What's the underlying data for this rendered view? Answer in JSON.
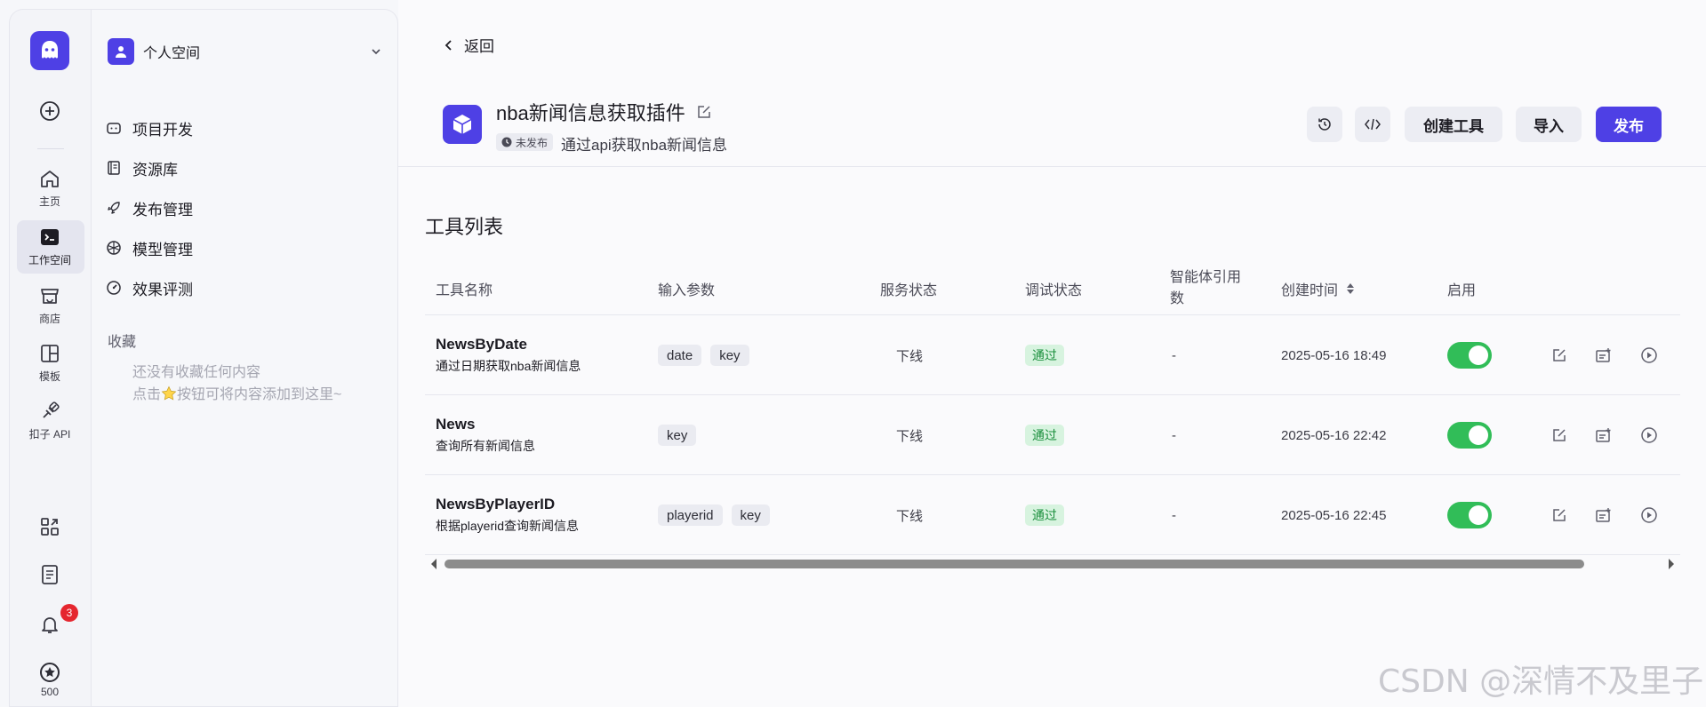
{
  "rail": {
    "items": [
      {
        "label": "",
        "icon": "plus-circle-icon"
      },
      {
        "label": "主页",
        "icon": "home-icon"
      },
      {
        "label": "工作空间",
        "icon": "terminal-icon"
      },
      {
        "label": "商店",
        "icon": "store-icon"
      },
      {
        "label": "模板",
        "icon": "template-icon"
      },
      {
        "label": "扣子 API",
        "icon": "api-icon"
      }
    ],
    "notification_count": "3",
    "points": "500"
  },
  "sidebar": {
    "space_name": "个人空间",
    "items": [
      {
        "label": "项目开发",
        "icon": "robot-icon"
      },
      {
        "label": "资源库",
        "icon": "library-icon"
      },
      {
        "label": "发布管理",
        "icon": "rocket-icon"
      },
      {
        "label": "模型管理",
        "icon": "model-icon"
      },
      {
        "label": "效果评测",
        "icon": "gauge-icon"
      }
    ],
    "favorites_title": "收藏",
    "favorites_empty_line1": "还没有收藏任何内容",
    "favorites_empty_line2_a": "点击",
    "favorites_empty_line2_b": "按钮可将内容添加到这里~"
  },
  "header": {
    "back_label": "返回",
    "plugin_name": "nba新闻信息获取插件",
    "status": "未发布",
    "description": "通过api获取nba新闻信息",
    "create_tool": "创建工具",
    "import": "导入",
    "publish": "发布"
  },
  "tool_list": {
    "title": "工具列表",
    "columns": {
      "name": "工具名称",
      "params": "输入参数",
      "service": "服务状态",
      "debug": "调试状态",
      "refs_line1": "智能体引用",
      "refs_line2": "数",
      "created": "创建时间",
      "enabled": "启用"
    },
    "rows": [
      {
        "name": "NewsByDate",
        "desc": "通过日期获取nba新闻信息",
        "params": [
          "date",
          "key"
        ],
        "service": "下线",
        "debug": "通过",
        "refs": "-",
        "created": "2025-05-16 18:49",
        "enabled": true
      },
      {
        "name": "News",
        "desc": "查询所有新闻信息",
        "params": [
          "key"
        ],
        "service": "下线",
        "debug": "通过",
        "refs": "-",
        "created": "2025-05-16 22:42",
        "enabled": true
      },
      {
        "name": "NewsByPlayerID",
        "desc": "根据playerid查询新闻信息",
        "params": [
          "playerid",
          "key"
        ],
        "service": "下线",
        "debug": "通过",
        "refs": "-",
        "created": "2025-05-16 22:45",
        "enabled": true
      }
    ]
  },
  "watermark": "CSDN @深情不及里子",
  "colors": {
    "accent": "#4e40e5",
    "success": "#31bd58",
    "badge": "#e5262f"
  }
}
